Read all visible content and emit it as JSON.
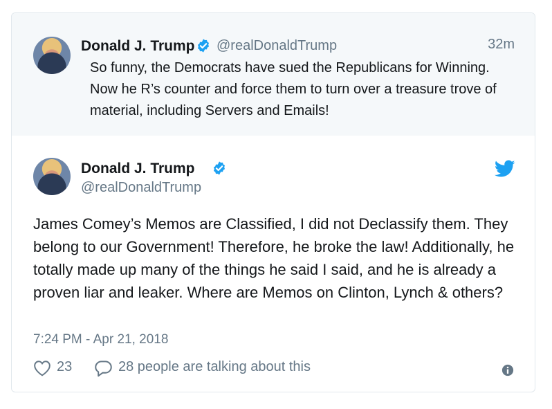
{
  "quoted_tweet": {
    "name": "Donald J. Trump",
    "handle": "@realDonaldTrump",
    "time": "32m",
    "text": "So funny, the Democrats have sued the Republicans for Winning. Now he R’s counter and force them to turn over a treasure trove of material, including Servers and Emails!"
  },
  "main_tweet": {
    "name": "Donald J. Trump",
    "handle": "@realDonaldTrump",
    "text": "James Comey’s Memos are Classified, I did not Declassify them. They belong to our Government! Therefore, he broke the law! Additionally, he totally made up many of the things he said I said, and he is already a proven liar and leaker. Where are Memos on Clinton, Lynch & others?",
    "timestamp": "7:24 PM - Apr 21, 2018",
    "likes": "23",
    "talking": "28 people are talking about this"
  },
  "colors": {
    "verified": "#1da1f2",
    "twitter_bird": "#1da1f2",
    "muted_text": "#657786",
    "quoted_background": "#f5f8fa"
  },
  "icons": [
    "verified-badge-icon",
    "twitter-bird-icon",
    "heart-icon",
    "reply-bubble-icon",
    "info-icon"
  ]
}
